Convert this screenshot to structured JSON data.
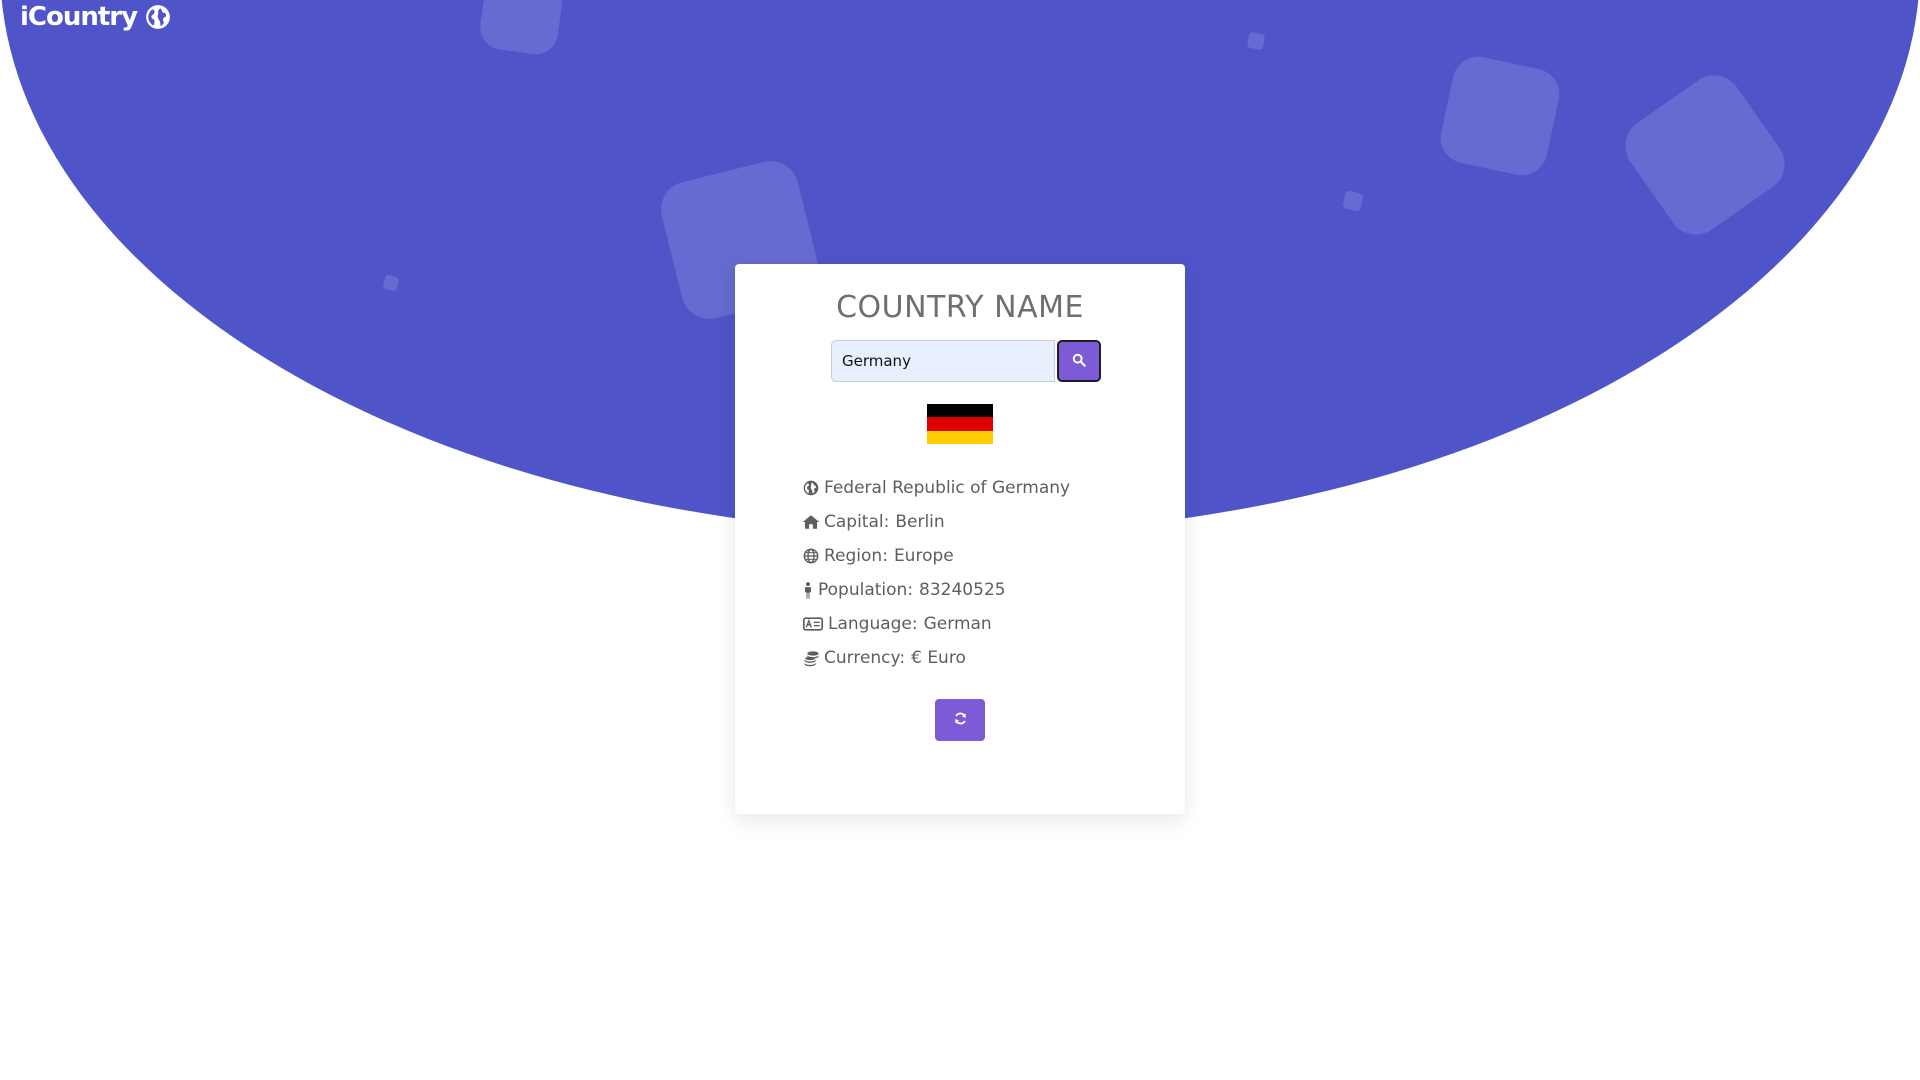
{
  "app": {
    "logo_text": "iCountry"
  },
  "card": {
    "title": "COUNTRY NAME",
    "search": {
      "value": "Germany",
      "placeholder": ""
    },
    "flag": {
      "country": "Germany",
      "colors": [
        "#000000",
        "#dd0000",
        "#ffce00"
      ]
    },
    "details": {
      "official_name": "Federal Republic of Germany",
      "capital_label": "Capital:",
      "capital": "Berlin",
      "region_label": "Region:",
      "region": "Europe",
      "population_label": "Population:",
      "population": "83240525",
      "language_label": "Language:",
      "language": "German",
      "currency_label": "Currency:",
      "currency": "€ Euro"
    }
  },
  "colors": {
    "hero_background": "#4f55c9",
    "accent": "#7e5bd6",
    "text": "#5e5e5e",
    "title": "#6f6f6f"
  },
  "icons": {
    "logo": "globe-icon",
    "search": "search-icon",
    "official_name": "globe-icon",
    "capital": "home-icon",
    "region": "globe-grid-icon",
    "population": "person-icon",
    "language": "id-card-icon",
    "currency": "coins-icon",
    "refresh": "refresh-icon"
  }
}
